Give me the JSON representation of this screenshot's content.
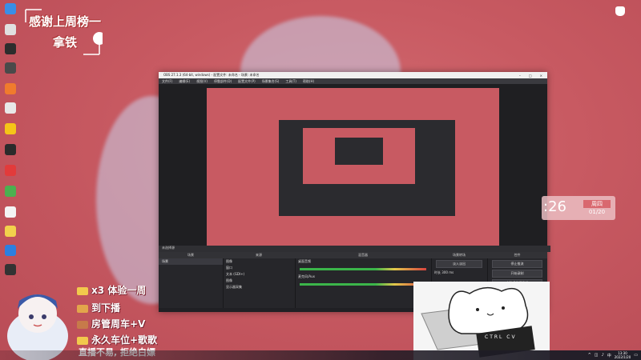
{
  "thanks_card": {
    "line1": "感谢上周榜一",
    "line2": "拿铁"
  },
  "obs": {
    "title": "OBS 27.1.3 (64-bit, windows) - 配置文件: 未命名 - 场景: 未命名",
    "menu": [
      "文件(F)",
      "编辑(E)",
      "视图(V)",
      "停靠部件(D)",
      "配置文件(P)",
      "场景集合(S)",
      "工具(T)",
      "帮助(H)"
    ],
    "status": "未选择源",
    "docks": {
      "scenes": {
        "header": "场景",
        "items": [
          "场景"
        ]
      },
      "sources": {
        "header": "来源",
        "items": [
          "图像",
          "窗口",
          "文本 (GDI+)",
          "图像",
          "显示器采集"
        ]
      },
      "mixer": {
        "header": "混音器",
        "tracks": [
          "桌面音频",
          "麦克风/Aux"
        ]
      },
      "transitions": {
        "header": "场景转场",
        "value": "淡入淡出",
        "duration_label": "时长",
        "duration": "300 ms"
      },
      "controls": {
        "header": "控件",
        "buttons": [
          "停止推流",
          "开始录制",
          "启动虚拟摄像机",
          "工作室模式",
          "设置",
          "退出"
        ]
      }
    }
  },
  "clock": {
    "time": ":26",
    "weekday": "周四",
    "date": "01/20"
  },
  "perks": [
    {
      "text": "x3 体验一周",
      "color": "#f2c94c"
    },
    {
      "text": "到下播",
      "color": "#e3a54b"
    },
    {
      "text": "房管周车+V",
      "color": "#c77a4a"
    },
    {
      "text": "永久车位+歌歌",
      "color": "#f2c94c"
    }
  ],
  "banner": "直播不易, 拒绝白嫖",
  "cat_keys": "CTRL CV",
  "taskbar": {
    "time": "13:30",
    "date": "2022/1/20",
    "lang": "中"
  },
  "colors": {
    "background": "#c85a62",
    "obs_dark": "#2b2b2f",
    "meter_green": "#3bb54a"
  }
}
